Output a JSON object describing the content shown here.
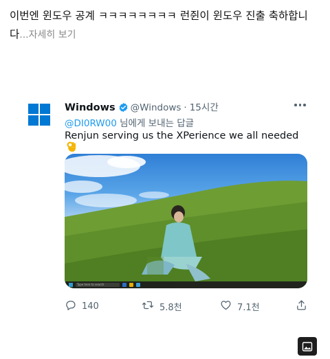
{
  "post": {
    "text": "이번엔 윈도우 공계 ㅋㅋㅋㅋㅋㅋㅋㅋ 런쥔이 윈도우 진출 축하합니다",
    "ellipsis": "...",
    "more_label": "자세히 보기"
  },
  "tweet": {
    "author_name": "Windows",
    "handle": "@Windows",
    "separator": "·",
    "time": "15시간",
    "reply_to_handle": "@DI0RW00",
    "reply_to_suffix": " 님에게 보내는 답글",
    "text": "Renjun serving us the XPerience we all needed",
    "emoji": "👌",
    "media_taskbar_search": "Type here to search",
    "stats": {
      "replies": "140",
      "retweets": "5.8천",
      "likes": "7.1천"
    }
  },
  "icons": {
    "logo": "windows-logo-icon",
    "verified": "verified-badge-icon",
    "more": "more-options-icon",
    "reply": "reply-icon",
    "retweet": "retweet-icon",
    "like": "heart-icon",
    "share": "share-icon",
    "photo": "image-icon"
  },
  "colors": {
    "accent": "#1d9bf0",
    "secondary_text": "#536471",
    "windows_blue": "#0078d4"
  }
}
